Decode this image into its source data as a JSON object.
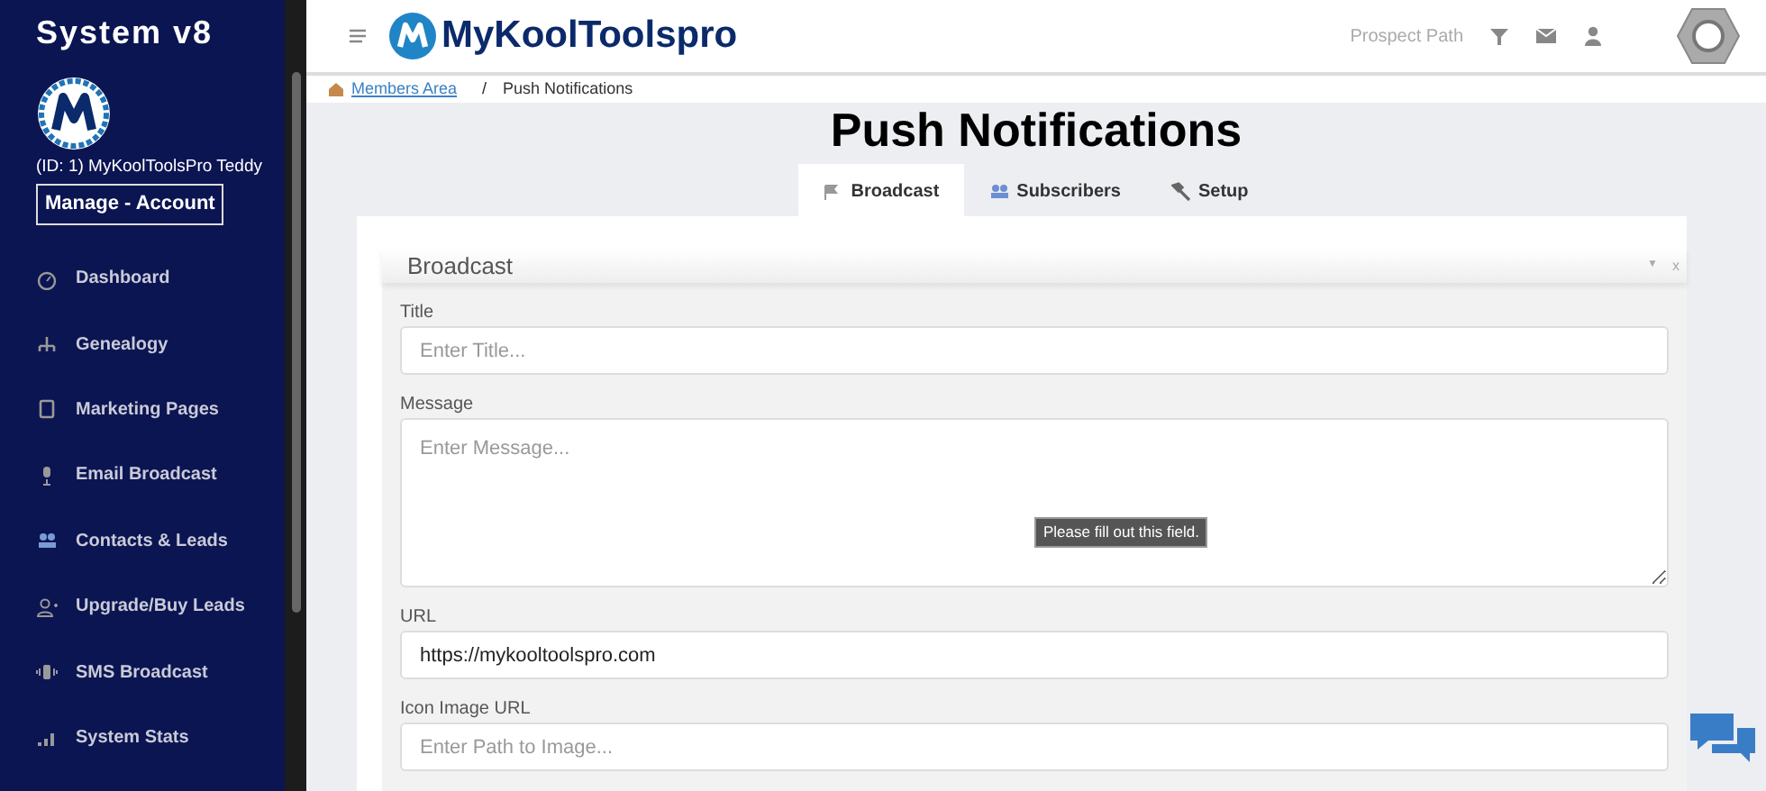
{
  "sidebar": {
    "brand": "System v8",
    "user": "(ID: 1) MyKoolToolsPro Teddy",
    "account_button": "Manage - Account",
    "items": [
      {
        "label": "Dashboard"
      },
      {
        "label": "Genealogy"
      },
      {
        "label": "Marketing Pages"
      },
      {
        "label": "Email Broadcast"
      },
      {
        "label": "Contacts & Leads"
      },
      {
        "label": "Upgrade/Buy Leads"
      },
      {
        "label": "SMS Broadcast"
      },
      {
        "label": "System Stats"
      }
    ]
  },
  "header": {
    "logo_text": "MyKoolToolspro",
    "link": "Prospect Path"
  },
  "breadcrumb": [
    {
      "label": "Members Area",
      "link": true
    },
    {
      "label": "Push Notifications",
      "link": false
    }
  ],
  "breadcrumb_separator": "/",
  "page_title": "Push Notifications",
  "tabs": [
    {
      "label": "Broadcast",
      "selected": true
    },
    {
      "label": "Subscribers",
      "selected": false
    },
    {
      "label": "Setup",
      "selected": false
    }
  ],
  "panel": {
    "title": "Broadcast",
    "collapse": "▼",
    "close": "x",
    "fields": [
      {
        "label": "Title",
        "kind": "input",
        "placeholder": "Enter Title..."
      },
      {
        "label": "Message",
        "kind": "textarea",
        "placeholder": "Enter Message...",
        "tooltip": "Please fill out this field."
      },
      {
        "label": "URL",
        "kind": "input",
        "value": "https://mykooltoolspro.com"
      },
      {
        "label": "Icon Image URL",
        "kind": "input",
        "placeholder": "Enter Path to Image..."
      }
    ]
  }
}
